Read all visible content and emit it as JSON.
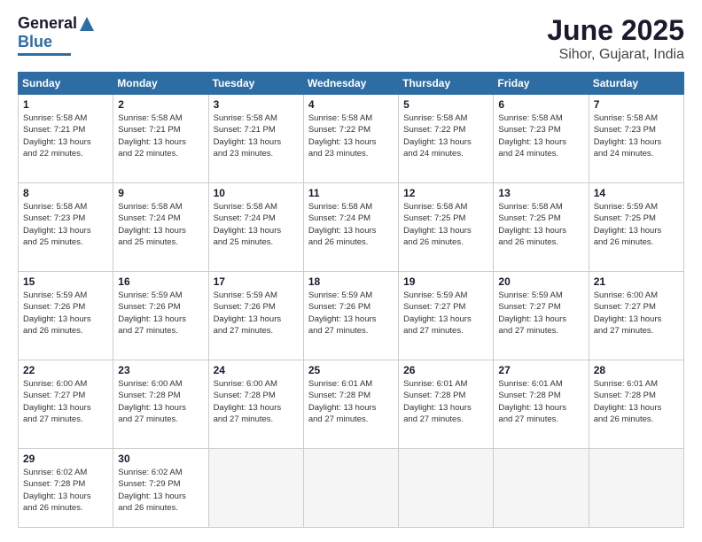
{
  "logo": {
    "line1": "General",
    "line2": "Blue"
  },
  "title": "June 2025",
  "subtitle": "Sihor, Gujarat, India",
  "weekdays": [
    "Sunday",
    "Monday",
    "Tuesday",
    "Wednesday",
    "Thursday",
    "Friday",
    "Saturday"
  ],
  "weeks": [
    [
      {
        "day": 1,
        "info": "Sunrise: 5:58 AM\nSunset: 7:21 PM\nDaylight: 13 hours\nand 22 minutes."
      },
      {
        "day": 2,
        "info": "Sunrise: 5:58 AM\nSunset: 7:21 PM\nDaylight: 13 hours\nand 22 minutes."
      },
      {
        "day": 3,
        "info": "Sunrise: 5:58 AM\nSunset: 7:21 PM\nDaylight: 13 hours\nand 23 minutes."
      },
      {
        "day": 4,
        "info": "Sunrise: 5:58 AM\nSunset: 7:22 PM\nDaylight: 13 hours\nand 23 minutes."
      },
      {
        "day": 5,
        "info": "Sunrise: 5:58 AM\nSunset: 7:22 PM\nDaylight: 13 hours\nand 24 minutes."
      },
      {
        "day": 6,
        "info": "Sunrise: 5:58 AM\nSunset: 7:23 PM\nDaylight: 13 hours\nand 24 minutes."
      },
      {
        "day": 7,
        "info": "Sunrise: 5:58 AM\nSunset: 7:23 PM\nDaylight: 13 hours\nand 24 minutes."
      }
    ],
    [
      {
        "day": 8,
        "info": "Sunrise: 5:58 AM\nSunset: 7:23 PM\nDaylight: 13 hours\nand 25 minutes."
      },
      {
        "day": 9,
        "info": "Sunrise: 5:58 AM\nSunset: 7:24 PM\nDaylight: 13 hours\nand 25 minutes."
      },
      {
        "day": 10,
        "info": "Sunrise: 5:58 AM\nSunset: 7:24 PM\nDaylight: 13 hours\nand 25 minutes."
      },
      {
        "day": 11,
        "info": "Sunrise: 5:58 AM\nSunset: 7:24 PM\nDaylight: 13 hours\nand 26 minutes."
      },
      {
        "day": 12,
        "info": "Sunrise: 5:58 AM\nSunset: 7:25 PM\nDaylight: 13 hours\nand 26 minutes."
      },
      {
        "day": 13,
        "info": "Sunrise: 5:58 AM\nSunset: 7:25 PM\nDaylight: 13 hours\nand 26 minutes."
      },
      {
        "day": 14,
        "info": "Sunrise: 5:59 AM\nSunset: 7:25 PM\nDaylight: 13 hours\nand 26 minutes."
      }
    ],
    [
      {
        "day": 15,
        "info": "Sunrise: 5:59 AM\nSunset: 7:26 PM\nDaylight: 13 hours\nand 26 minutes."
      },
      {
        "day": 16,
        "info": "Sunrise: 5:59 AM\nSunset: 7:26 PM\nDaylight: 13 hours\nand 27 minutes."
      },
      {
        "day": 17,
        "info": "Sunrise: 5:59 AM\nSunset: 7:26 PM\nDaylight: 13 hours\nand 27 minutes."
      },
      {
        "day": 18,
        "info": "Sunrise: 5:59 AM\nSunset: 7:26 PM\nDaylight: 13 hours\nand 27 minutes."
      },
      {
        "day": 19,
        "info": "Sunrise: 5:59 AM\nSunset: 7:27 PM\nDaylight: 13 hours\nand 27 minutes."
      },
      {
        "day": 20,
        "info": "Sunrise: 5:59 AM\nSunset: 7:27 PM\nDaylight: 13 hours\nand 27 minutes."
      },
      {
        "day": 21,
        "info": "Sunrise: 6:00 AM\nSunset: 7:27 PM\nDaylight: 13 hours\nand 27 minutes."
      }
    ],
    [
      {
        "day": 22,
        "info": "Sunrise: 6:00 AM\nSunset: 7:27 PM\nDaylight: 13 hours\nand 27 minutes."
      },
      {
        "day": 23,
        "info": "Sunrise: 6:00 AM\nSunset: 7:28 PM\nDaylight: 13 hours\nand 27 minutes."
      },
      {
        "day": 24,
        "info": "Sunrise: 6:00 AM\nSunset: 7:28 PM\nDaylight: 13 hours\nand 27 minutes."
      },
      {
        "day": 25,
        "info": "Sunrise: 6:01 AM\nSunset: 7:28 PM\nDaylight: 13 hours\nand 27 minutes."
      },
      {
        "day": 26,
        "info": "Sunrise: 6:01 AM\nSunset: 7:28 PM\nDaylight: 13 hours\nand 27 minutes."
      },
      {
        "day": 27,
        "info": "Sunrise: 6:01 AM\nSunset: 7:28 PM\nDaylight: 13 hours\nand 27 minutes."
      },
      {
        "day": 28,
        "info": "Sunrise: 6:01 AM\nSunset: 7:28 PM\nDaylight: 13 hours\nand 26 minutes."
      }
    ],
    [
      {
        "day": 29,
        "info": "Sunrise: 6:02 AM\nSunset: 7:28 PM\nDaylight: 13 hours\nand 26 minutes."
      },
      {
        "day": 30,
        "info": "Sunrise: 6:02 AM\nSunset: 7:29 PM\nDaylight: 13 hours\nand 26 minutes."
      },
      null,
      null,
      null,
      null,
      null
    ]
  ]
}
